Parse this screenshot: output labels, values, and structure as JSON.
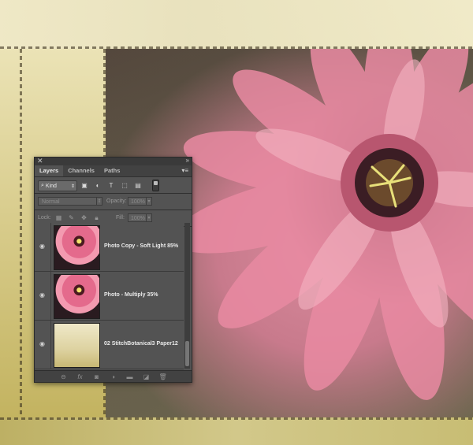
{
  "panel": {
    "close_glyph": "✕",
    "collapse_glyph": "»",
    "tabs": [
      {
        "label": "Layers",
        "active": true
      },
      {
        "label": "Channels",
        "active": false
      },
      {
        "label": "Paths",
        "active": false
      }
    ],
    "menu_glyph": "▾≡",
    "filter": {
      "kind_label": "Kind",
      "icons": [
        "image-filter-icon",
        "adjustment-filter-icon",
        "type-filter-icon",
        "shape-filter-icon",
        "smart-object-filter-icon"
      ]
    },
    "blend_mode": "Normal",
    "opacity_label": "Opacity:",
    "opacity_value": "100%",
    "lock_label": "Lock:",
    "fill_label": "Fill:",
    "fill_value": "100%",
    "layers": [
      {
        "name": "Photo Copy - Soft Light 85%",
        "thumb": "flower",
        "visible": true
      },
      {
        "name": "Photo - Multiply 35%",
        "thumb": "flower",
        "visible": true
      },
      {
        "name": "02 StitchBotanical3 Paper12",
        "thumb": "paper",
        "visible": true
      }
    ],
    "footer_icons": [
      "link-layers-icon",
      "fx-icon",
      "mask-icon",
      "adjustment-layer-icon",
      "group-folder-icon",
      "new-layer-icon",
      "trash-icon"
    ]
  }
}
